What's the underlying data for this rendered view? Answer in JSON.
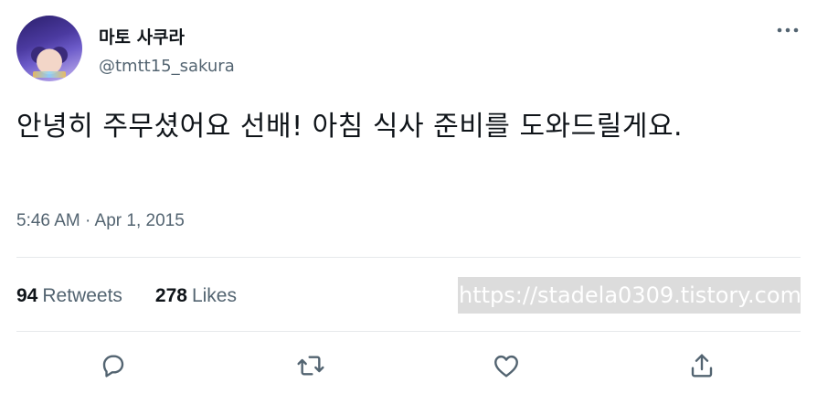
{
  "tweet": {
    "author": {
      "display_name": "마토 사쿠라",
      "handle": "@tmtt15_sakura",
      "avatar_icon": "anime-avatar"
    },
    "text": "안녕히 주무셨어요 선배! 아침 식사 준비를 도와드릴게요.",
    "timestamp": "5:46 AM · Apr 1, 2015",
    "stats": {
      "retweets": {
        "count": "94",
        "label": "Retweets"
      },
      "likes": {
        "count": "278",
        "label": "Likes"
      }
    },
    "watermark": "https://stadela0309.tistory.com",
    "actions": {
      "reply_icon": "speech-bubble-icon",
      "retweet_icon": "retweet-icon",
      "like_icon": "heart-icon",
      "share_icon": "share-icon",
      "more_icon": "more-dots-icon"
    }
  },
  "colors": {
    "text_primary": "#0f1419",
    "text_secondary": "#536471",
    "divider": "#e6e9eb",
    "icon": "#536471",
    "watermark_bg": "#dcdcdc"
  }
}
